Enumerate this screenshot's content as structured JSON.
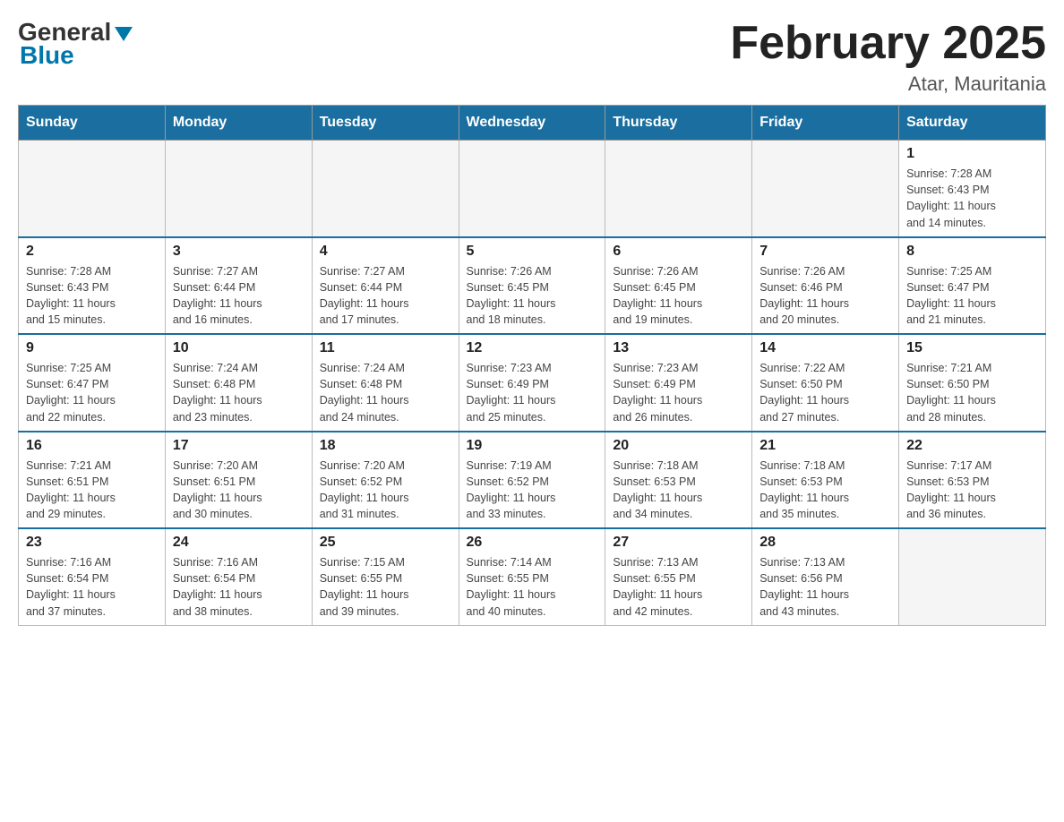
{
  "header": {
    "logo_general": "General",
    "logo_blue": "Blue",
    "title": "February 2025",
    "subtitle": "Atar, Mauritania"
  },
  "days_of_week": [
    "Sunday",
    "Monday",
    "Tuesday",
    "Wednesday",
    "Thursday",
    "Friday",
    "Saturday"
  ],
  "weeks": [
    [
      {
        "day": "",
        "info": ""
      },
      {
        "day": "",
        "info": ""
      },
      {
        "day": "",
        "info": ""
      },
      {
        "day": "",
        "info": ""
      },
      {
        "day": "",
        "info": ""
      },
      {
        "day": "",
        "info": ""
      },
      {
        "day": "1",
        "info": "Sunrise: 7:28 AM\nSunset: 6:43 PM\nDaylight: 11 hours\nand 14 minutes."
      }
    ],
    [
      {
        "day": "2",
        "info": "Sunrise: 7:28 AM\nSunset: 6:43 PM\nDaylight: 11 hours\nand 15 minutes."
      },
      {
        "day": "3",
        "info": "Sunrise: 7:27 AM\nSunset: 6:44 PM\nDaylight: 11 hours\nand 16 minutes."
      },
      {
        "day": "4",
        "info": "Sunrise: 7:27 AM\nSunset: 6:44 PM\nDaylight: 11 hours\nand 17 minutes."
      },
      {
        "day": "5",
        "info": "Sunrise: 7:26 AM\nSunset: 6:45 PM\nDaylight: 11 hours\nand 18 minutes."
      },
      {
        "day": "6",
        "info": "Sunrise: 7:26 AM\nSunset: 6:45 PM\nDaylight: 11 hours\nand 19 minutes."
      },
      {
        "day": "7",
        "info": "Sunrise: 7:26 AM\nSunset: 6:46 PM\nDaylight: 11 hours\nand 20 minutes."
      },
      {
        "day": "8",
        "info": "Sunrise: 7:25 AM\nSunset: 6:47 PM\nDaylight: 11 hours\nand 21 minutes."
      }
    ],
    [
      {
        "day": "9",
        "info": "Sunrise: 7:25 AM\nSunset: 6:47 PM\nDaylight: 11 hours\nand 22 minutes."
      },
      {
        "day": "10",
        "info": "Sunrise: 7:24 AM\nSunset: 6:48 PM\nDaylight: 11 hours\nand 23 minutes."
      },
      {
        "day": "11",
        "info": "Sunrise: 7:24 AM\nSunset: 6:48 PM\nDaylight: 11 hours\nand 24 minutes."
      },
      {
        "day": "12",
        "info": "Sunrise: 7:23 AM\nSunset: 6:49 PM\nDaylight: 11 hours\nand 25 minutes."
      },
      {
        "day": "13",
        "info": "Sunrise: 7:23 AM\nSunset: 6:49 PM\nDaylight: 11 hours\nand 26 minutes."
      },
      {
        "day": "14",
        "info": "Sunrise: 7:22 AM\nSunset: 6:50 PM\nDaylight: 11 hours\nand 27 minutes."
      },
      {
        "day": "15",
        "info": "Sunrise: 7:21 AM\nSunset: 6:50 PM\nDaylight: 11 hours\nand 28 minutes."
      }
    ],
    [
      {
        "day": "16",
        "info": "Sunrise: 7:21 AM\nSunset: 6:51 PM\nDaylight: 11 hours\nand 29 minutes."
      },
      {
        "day": "17",
        "info": "Sunrise: 7:20 AM\nSunset: 6:51 PM\nDaylight: 11 hours\nand 30 minutes."
      },
      {
        "day": "18",
        "info": "Sunrise: 7:20 AM\nSunset: 6:52 PM\nDaylight: 11 hours\nand 31 minutes."
      },
      {
        "day": "19",
        "info": "Sunrise: 7:19 AM\nSunset: 6:52 PM\nDaylight: 11 hours\nand 33 minutes."
      },
      {
        "day": "20",
        "info": "Sunrise: 7:18 AM\nSunset: 6:53 PM\nDaylight: 11 hours\nand 34 minutes."
      },
      {
        "day": "21",
        "info": "Sunrise: 7:18 AM\nSunset: 6:53 PM\nDaylight: 11 hours\nand 35 minutes."
      },
      {
        "day": "22",
        "info": "Sunrise: 7:17 AM\nSunset: 6:53 PM\nDaylight: 11 hours\nand 36 minutes."
      }
    ],
    [
      {
        "day": "23",
        "info": "Sunrise: 7:16 AM\nSunset: 6:54 PM\nDaylight: 11 hours\nand 37 minutes."
      },
      {
        "day": "24",
        "info": "Sunrise: 7:16 AM\nSunset: 6:54 PM\nDaylight: 11 hours\nand 38 minutes."
      },
      {
        "day": "25",
        "info": "Sunrise: 7:15 AM\nSunset: 6:55 PM\nDaylight: 11 hours\nand 39 minutes."
      },
      {
        "day": "26",
        "info": "Sunrise: 7:14 AM\nSunset: 6:55 PM\nDaylight: 11 hours\nand 40 minutes."
      },
      {
        "day": "27",
        "info": "Sunrise: 7:13 AM\nSunset: 6:55 PM\nDaylight: 11 hours\nand 42 minutes."
      },
      {
        "day": "28",
        "info": "Sunrise: 7:13 AM\nSunset: 6:56 PM\nDaylight: 11 hours\nand 43 minutes."
      },
      {
        "day": "",
        "info": ""
      }
    ]
  ]
}
